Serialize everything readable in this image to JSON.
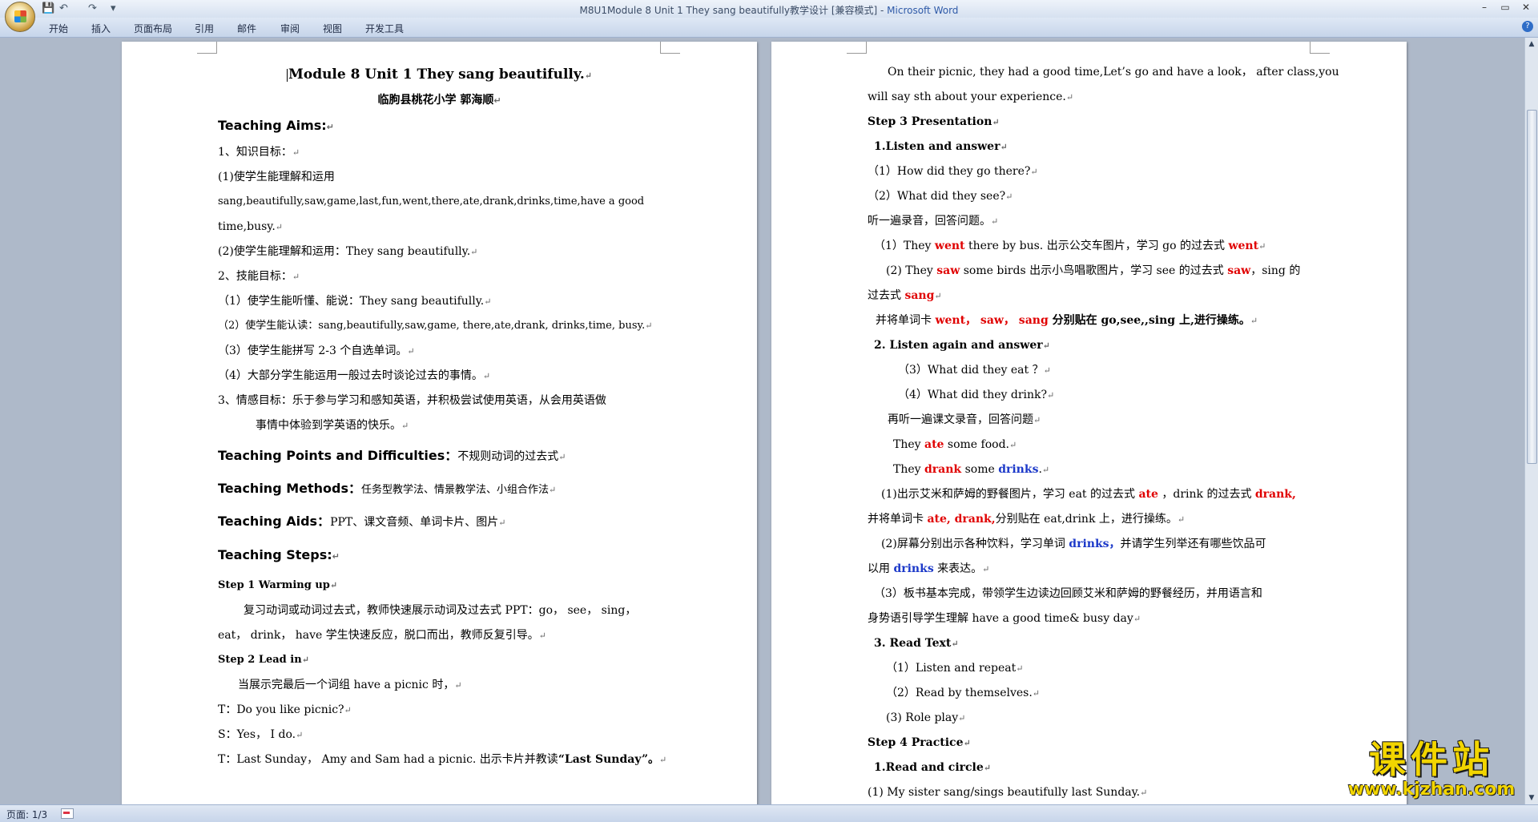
{
  "window": {
    "title": "M8U1Module 8 Unit 1 They sang beautifully教学设计 [兼容模式] - ",
    "app_name": "Microsoft Word",
    "minimize": "–",
    "maximize": "▭",
    "close": "✕"
  },
  "quick_access": {
    "save": "💾",
    "undo": "↶",
    "redo": "↷",
    "more": "▾"
  },
  "ribbon_tabs": [
    "开始",
    "插入",
    "页面布局",
    "引用",
    "邮件",
    "审阅",
    "视图",
    "开发工具"
  ],
  "help": "?",
  "page1": {
    "title": "Module  8 Unit  1 They sang beautifully.",
    "subtitle": "临朐县桃花小学    郭海顺",
    "aims_heading": "Teaching Aims:",
    "l1": "1、知识目标：",
    "l2": "(1)使学生能理解和运用",
    "l3": "sang,beautifully,saw,game,last,fun,went,there,ate,drank,drinks,time,have a good",
    "l4": "time,busy.",
    "l5": "(2)使学生能理解和运用：They sang beautifully.",
    "l6": "2、技能目标：",
    "l7": "（1）使学生能听懂、能说：They sang beautifully.",
    "l8": "（2）使学生能认读：sang,beautifully,saw,game, there,ate,drank, drinks,time, busy.",
    "l9": "（3）使学生能拼写 2-3 个自选单词。",
    "l10": "（4）大部分学生能运用一般过去时谈论过去的事情。",
    "l11": "3、情感目标：乐于参与学习和感知英语，并积极尝试使用英语，从会用英语做",
    "l12": "事情中体验到学英语的快乐。",
    "points_heading": "Teaching Points and Difficulties：",
    "points_text": "不规则动词的过去式",
    "methods_heading": "Teaching Methods：",
    "methods_text": "任务型教学法、情景教学法、小组合作法",
    "aids_heading": "Teaching Aids：",
    "aids_text": "PPT、课文音频、单词卡片、图片",
    "steps_heading": "Teaching Steps:",
    "step1": "Step 1 Warming up",
    "s1a": "复习动词或动词过去式，教师快速展示动词及过去式 PPT：go， see， sing，",
    "s1b": "eat， drink， have 学生快速反应，脱口而出，教师反复引导。",
    "step2": "Step 2 Lead in",
    "s2a": "当展示完最后一个词组 have a picnic 时，",
    "s2b": "T：Do you like picnic?",
    "s2c": "S：Yes， I do.",
    "s2d_a": "T：Last Sunday， Amy and Sam had a picnic.  出示卡片并教读",
    "s2d_b": "“Last Sunday”。"
  },
  "page2": {
    "p1": "On their picnic, they had a good time,Let’s go and have a look， after class,you",
    "p2": "will say sth about your experience.",
    "step3": "Step 3     Presentation",
    "h1": "1.Listen and answer",
    "q1": "（1）How did they go there?",
    "q2": "（2）What did they see?",
    "listen1": "听一遍录音，回答问题。",
    "a1_pre": "（1）They ",
    "a1_w1": "went",
    "a1_mid": " there by bus.  出示公交车图片，学习 go 的过去式 ",
    "a1_w2": "went",
    "a2_pre": "(2) They ",
    "a2_w1": "saw",
    "a2_mid": " some birds 出示小鸟唱歌图片，学习 see 的过去式 ",
    "a2_w2": "saw",
    "a2_post": "，sing 的",
    "a2b_pre": "过去式 ",
    "a2b_w": "sang",
    "cards_pre": "并将单词卡 ",
    "cards_words": "went， saw， sang",
    "cards_post": " 分别贴在 go,see,,sing 上,进行操练。",
    "h2": "2. Listen again and answer",
    "q3": "（3）What did they eat  ？",
    "q4": "（4）What did they drink?",
    "listen2": "再听一遍课文录音，回答问题",
    "ate_pre": "They ",
    "ate_w": "ate",
    "ate_post": " some food.",
    "drank_pre": "They ",
    "drank_w": "drank",
    "drank_mid": " some ",
    "drank_w2": "drinks",
    "drank_post": ".",
    "b1_pre": "(1)出示艾米和萨姆的野餐图片，学习 eat 的过去式 ",
    "b1_w1": "ate",
    "b1_mid": "  ，drink 的过去式 ",
    "b1_w2": "drank,",
    "b2_pre": "并将单词卡 ",
    "b2_w": "ate, drank,",
    "b2_post": "分别贴在 eat,drink 上，进行操练。",
    "c1_pre": "(2)屏幕分别出示各种饮料，学习单词 ",
    "c1_w": "drinks，",
    "c1_post": "并请学生列举还有哪些饮品可",
    "c2_pre": "以用 ",
    "c2_w": "drinks",
    "c2_post": " 来表达。",
    "d1": "（3）板书基本完成，带领学生边读边回顾艾米和萨姆的野餐经历，并用语言和",
    "d2": "身势语引导学生理解 have a good time& busy  day",
    "h3": "3. Read Text",
    "r1": "（1）Listen and repeat",
    "r2": "（2）Read by themselves.",
    "r3": "(3) Role play",
    "step4": "Step 4 Practice",
    "h4": "1.Read and circle",
    "e1": "(1) My sister          sang/sings beautifully last Sunday."
  },
  "para_mark": "↵",
  "status": {
    "page": "页面: 1/3"
  },
  "watermark": {
    "cn": "课件站",
    "url": "www.kjzhan.com"
  },
  "colors": {
    "highlight_red": "#e00000",
    "highlight_blue": "#1c39c9",
    "app_title": "#2f5aa8"
  }
}
